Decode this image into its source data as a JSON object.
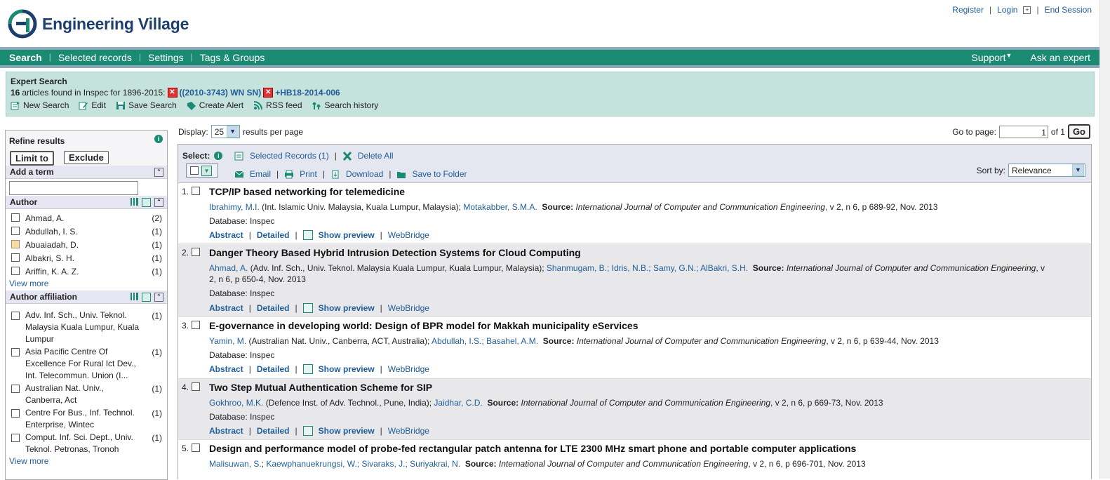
{
  "brand": {
    "name": "Engineering Village"
  },
  "toplinks": {
    "register": "Register",
    "login": "Login",
    "expand": "+",
    "end": "End Session"
  },
  "nav": {
    "left": [
      "Search",
      "Selected records",
      "Settings",
      "Tags & Groups"
    ],
    "support": "Support",
    "ask": "Ask an expert",
    "color": "#1a8a73"
  },
  "expert": {
    "title": "Expert Search",
    "count": "16",
    "found_text": "articles found in Inspec for 1896-2015:",
    "term1": "((2010-3743) WN SN)",
    "term2": "+HB18-2014-006",
    "actions": [
      "New Search",
      "Edit",
      "Save Search",
      "Create Alert",
      "RSS feed",
      "Search history"
    ]
  },
  "refine": {
    "title": "Refine results",
    "limit": "Limit to",
    "exclude": "Exclude",
    "add_term": "Add a term",
    "author_title": "Author",
    "authors": [
      {
        "name": "Ahmad, A.",
        "count": "(2)"
      },
      {
        "name": "Abdullah, I. S.",
        "count": "(1)"
      },
      {
        "name": "Abuaiadah, D.",
        "count": "(1)"
      },
      {
        "name": "Albakri, S. H.",
        "count": "(1)"
      },
      {
        "name": "Ariffin, K. A. Z.",
        "count": "(1)"
      }
    ],
    "view_more": "View more",
    "affil_title": "Author affiliation",
    "affiliations": [
      {
        "name": "Adv. Inf. Sch., Univ. Teknol. Malaysia Kuala Lumpur, Kuala Lumpur",
        "count": "(1)"
      },
      {
        "name": "Asia Pacific Centre Of Excellence For Rural Ict Dev., Int. Telecommun. Union (I...",
        "count": "(1)"
      },
      {
        "name": "Australian Nat. Univ., Canberra, Act",
        "count": "(1)"
      },
      {
        "name": "Centre For Bus., Inf. Technol. Enterprise, Wintec",
        "count": "(1)"
      },
      {
        "name": "Comput. Inf. Sci. Dept., Univ. Teknol. Petronas, Tronoh",
        "count": "(1)"
      }
    ],
    "view_more2": "View more"
  },
  "display": {
    "label": "Display:",
    "value": "25",
    "suffix": "results per page"
  },
  "goto": {
    "label": "Go to page:",
    "value": "1",
    "of": "of 1",
    "go": "Go"
  },
  "toolbar": {
    "select": "Select:",
    "selected_records": "Selected Records (1)",
    "delete_all": "Delete All",
    "email": "Email",
    "print": "Print",
    "download": "Download",
    "save_folder": "Save to Folder",
    "sort_label": "Sort by:",
    "sort_value": "Relevance"
  },
  "record_links": {
    "abstract": "Abstract",
    "detailed": "Detailed",
    "preview": "Show preview",
    "webbridge": "WebBridge",
    "db_label": "Database:",
    "db_value": "Inspec",
    "source_label": "Source:"
  },
  "records": [
    {
      "num": "1.",
      "title": "TCP/IP based networking for telemedicine",
      "a1": "Ibrahimy, M.I.",
      "a1_affil": " (Int. Islamic Univ. Malaysia, Kuala Lumpur, Malaysia); ",
      "others": "Motakabber, S.M.A.",
      "journal": "International Journal of Computer and Communication Engineering",
      "cite": ", v 2, n 6, p 689-92, Nov. 2013"
    },
    {
      "num": "2.",
      "title": "Danger Theory Based Hybrid Intrusion Detection Systems for Cloud Computing",
      "a1": "Ahmad, A.",
      "a1_affil": " (Adv. Inf. Sch., Univ. Teknol. Malaysia Kuala Lumpur, Kuala Lumpur, Malaysia); ",
      "others": "Shanmugam, B.; Idris, N.B.; Samy, G.N.; AlBakri, S.H.",
      "journal": "International Journal of Computer and Communication Engineering",
      "cite": ", v 2, n 6, p 650-4, Nov. 2013"
    },
    {
      "num": "3.",
      "title": "E-governance in developing world: Design of BPR model for Makkah municipality eServices",
      "a1": "Yamin, M.",
      "a1_affil": " (Australian Nat. Univ., Canberra, ACT, Australia); ",
      "others": "Abdullah, I.S.; Basahel, A.M.",
      "journal": "International Journal of Computer and Communication Engineering",
      "cite": ", v 2, n 6, p 639-44, Nov. 2013"
    },
    {
      "num": "4.",
      "title": "Two Step Mutual Authentication Scheme for SIP",
      "a1": "Gokhroo, M.K.",
      "a1_affil": " (Defence Inst. of Adv. Technol., Pune, India); ",
      "others": "Jaidhar, C.D.",
      "journal": "International Journal of Computer and Communication Engineering",
      "cite": ", v 2, n 6, p 669-73, Nov. 2013"
    },
    {
      "num": "5.",
      "title": "Design and performance model of probe-fed rectangular patch antenna for LTE 2300 MHz smart phone and portable computer applications",
      "a1": "Malisuwan, S.",
      "a1_affil": "; ",
      "others": "Kaewphanuekrungsi, W.; Sivaraks, J.; Suriyakrai, N.",
      "journal": "International Journal of Computer and Communication Engineering",
      "cite": ", v 2, n 6, p 696-701, Nov. 2013"
    }
  ]
}
